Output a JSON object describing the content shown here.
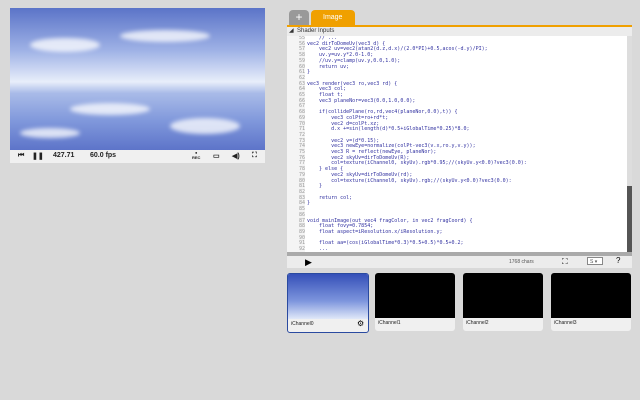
{
  "player": {
    "time": "427.71",
    "fps": "60.0 fps",
    "rec_label": "REC"
  },
  "editor": {
    "tabs": [
      {
        "label": "+"
      },
      {
        "label": "Image"
      }
    ],
    "shader_inputs": "Shader Inputs",
    "line_numbers": [
      "55",
      "56",
      "57",
      "58",
      "59",
      "60",
      "61",
      "62",
      "63",
      "64",
      "65",
      "66",
      "67",
      "68",
      "69",
      "70",
      "71",
      "72",
      "73",
      "74",
      "75",
      "76",
      "77",
      "78",
      "79",
      "80",
      "81",
      "82",
      "83",
      "84",
      "85",
      "86",
      "87",
      "88",
      "89",
      "90",
      "91",
      "92"
    ],
    "code": "    // ...\nvec2 dirToDomeUv(vec3 d) {\n    vec2 uv=vec2(atan2(d.z,d.x)/(2.0*PI)+0.5,acos(-d.y)/PI);\n    uv.y=uv.y*2.0-1.0;\n    //uv.y=clamp(uv.y,0.0,1.0);\n    return uv;\n}\n\nvec3 render(vec3 ro,vec3 rd) {\n    vec3 col;\n    float t;\n    vec3 planeNor=vec3(0.0,1.0,0.0);\n\n    if(collidePlane(ro,rd,vec4(planeNor,0.0),t)) {\n        vec3 colPt=ro+rd*t;\n        vec2 d=colPt.xz;\n        d.x +=sin(length(d)*0.5+iGlobalTime*0.25)*8.0;\n\n        vec2 v=(d*0.15);\n        vec3 newEye=normalize(colPt-vec3(v.x,ro.y,v.y));\n        vec3 R = reflect(newEye, planeNor);\n        vec2 skyUv=dirToDomeUv(R);\n        col=texture(iChannel0, skyUv).rgb*0.95;//(skyUv.y<0.0)?vec3(0.0):\n    } else {\n        vec2 skyUv=dirToDomeUv(rd);\n        col=texture(iChannel0, skyUv).rgb;//(skyUv.y<0.0)?vec3(0.0):\n    }\n\n    return col;\n}\n\n\nvoid mainImage(out vec4 fragColor, in vec2 fragCoord) {\n    float fovy=0.7854;\n    float aspect=iResolution.x/iResolution.y;\n\n    float aa=(cos(iGlobalTime*0.3)*0.5+0.5)*0.5+0.2;\n    ...",
    "chars": "1768 chars",
    "font_size": "S",
    "help": "?"
  },
  "channels": [
    {
      "label": "iChannel0"
    },
    {
      "label": "iChannel1"
    },
    {
      "label": "iChannel2"
    },
    {
      "label": "iChannel3"
    }
  ],
  "colors": {
    "accent": "#f0a000"
  }
}
